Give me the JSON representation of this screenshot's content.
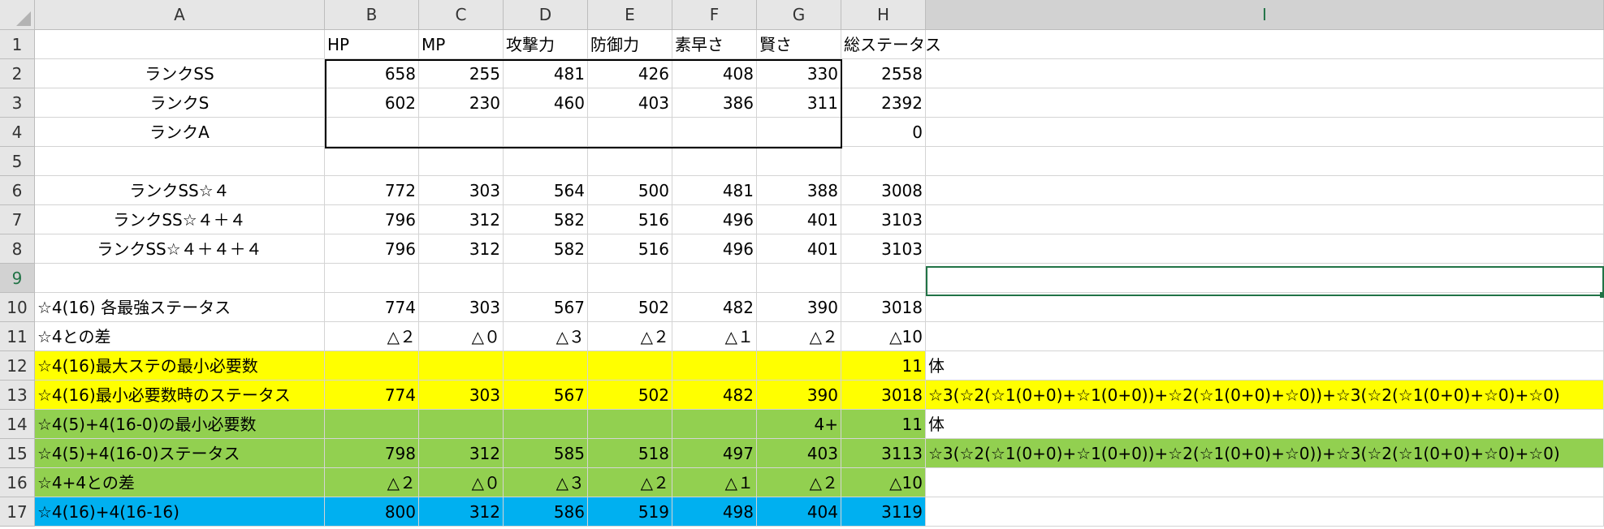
{
  "columns": [
    "A",
    "B",
    "C",
    "D",
    "E",
    "F",
    "G",
    "H",
    "I"
  ],
  "rows": [
    "1",
    "2",
    "3",
    "4",
    "5",
    "6",
    "7",
    "8",
    "9",
    "10",
    "11",
    "12",
    "13",
    "14",
    "15",
    "16",
    "17"
  ],
  "cells": {
    "B1": "HP",
    "C1": "MP",
    "D1": "攻撃力",
    "E1": "防御力",
    "F1": "素早さ",
    "G1": "賢さ",
    "H1": "総ステータス",
    "A2": "ランクSS",
    "B2": "658",
    "C2": "255",
    "D2": "481",
    "E2": "426",
    "F2": "408",
    "G2": "330",
    "H2": "2558",
    "A3": "ランクS",
    "B3": "602",
    "C3": "230",
    "D3": "460",
    "E3": "403",
    "F3": "386",
    "G3": "311",
    "H3": "2392",
    "A4": "ランクA",
    "H4": "0",
    "A6": "ランクSS☆４",
    "B6": "772",
    "C6": "303",
    "D6": "564",
    "E6": "500",
    "F6": "481",
    "G6": "388",
    "H6": "3008",
    "A7": "ランクSS☆４＋４",
    "B7": "796",
    "C7": "312",
    "D7": "582",
    "E7": "516",
    "F7": "496",
    "G7": "401",
    "H7": "3103",
    "A8": "ランクSS☆４＋４＋４",
    "B8": "796",
    "C8": "312",
    "D8": "582",
    "E8": "516",
    "F8": "496",
    "G8": "401",
    "H8": "3103",
    "A10": "☆4(16) 各最強ステータス",
    "B10": "774",
    "C10": "303",
    "D10": "567",
    "E10": "502",
    "F10": "482",
    "G10": "390",
    "H10": "3018",
    "A11": "☆4との差",
    "B11": "△２",
    "C11": "△０",
    "D11": "△３",
    "E11": "△２",
    "F11": "△１",
    "G11": "△２",
    "H11": "△10",
    "A12": "☆4(16)最大ステの最小必要数",
    "H12": "11",
    "I12": "体",
    "A13": "☆4(16)最小必要数時のステータス",
    "B13": "774",
    "C13": "303",
    "D13": "567",
    "E13": "502",
    "F13": "482",
    "G13": "390",
    "H13": "3018",
    "I13": "☆3(☆2(☆1(0+0)+☆1(0+0))+☆2(☆1(0+0)+☆0))+☆3(☆2(☆1(0+0)+☆0)+☆0)",
    "A14": "☆4(5)+4(16-0)の最小必要数",
    "G14": "4+",
    "H14": "11",
    "I14": "体",
    "A15": "☆4(5)+4(16-0)ステータス",
    "B15": "798",
    "C15": "312",
    "D15": "585",
    "E15": "518",
    "F15": "497",
    "G15": "403",
    "H15": "3113",
    "I15": "☆3(☆2(☆1(0+0)+☆1(0+0))+☆2(☆1(0+0)+☆0))+☆3(☆2(☆1(0+0)+☆0)+☆0)",
    "A16": "☆4+4との差",
    "B16": "△２",
    "C16": "△０",
    "D16": "△３",
    "E16": "△２",
    "F16": "△１",
    "G16": "△２",
    "H16": "△10",
    "A17": "☆4(16)+4(16-16)",
    "B17": "800",
    "C17": "312",
    "D17": "586",
    "E17": "519",
    "F17": "498",
    "G17": "404",
    "H17": "3119"
  },
  "selected_cell": "I9",
  "colors": {
    "yellow": "#ffff00",
    "green": "#92d050",
    "blue": "#00b0f0",
    "selection": "#217346"
  }
}
